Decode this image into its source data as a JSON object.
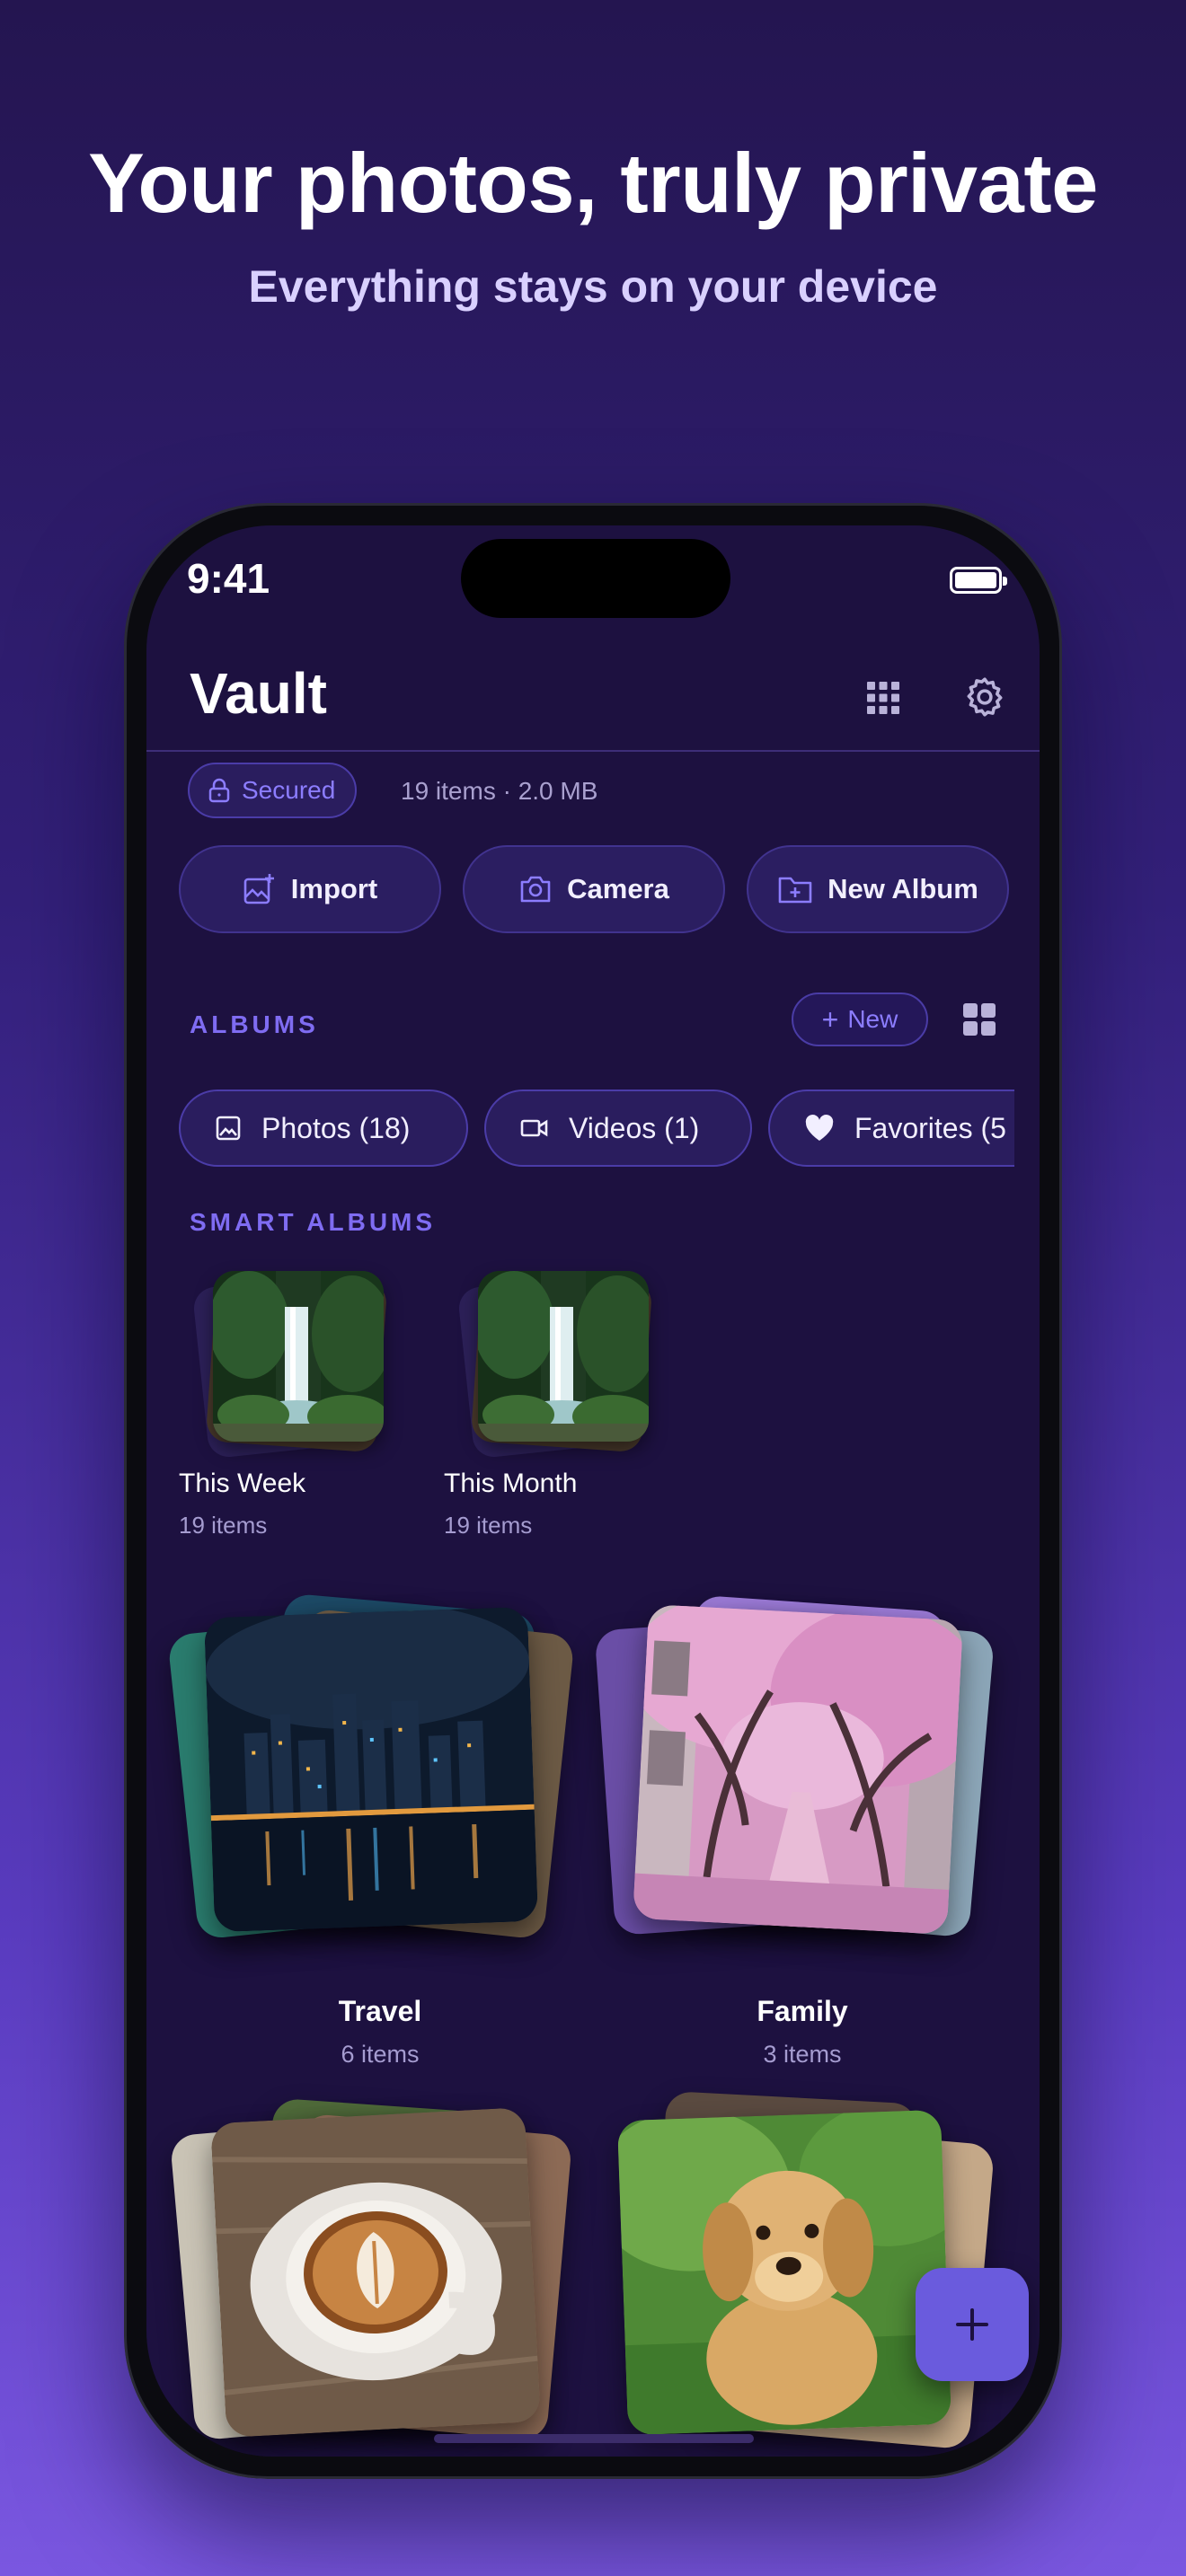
{
  "hero": {
    "title": "Your photos, truly private",
    "subtitle": "Everything stays on your device"
  },
  "status_bar": {
    "time": "9:41"
  },
  "header": {
    "title": "Vault",
    "grid_icon": "grid-icon",
    "settings_icon": "gear-icon"
  },
  "info": {
    "badge": "Secured",
    "meta": "19 items · 2.0 MB"
  },
  "actions": [
    {
      "label": "Import",
      "icon": "import-photo-icon"
    },
    {
      "label": "Camera",
      "icon": "camera-icon"
    },
    {
      "label": "New Album",
      "icon": "folder-plus-icon"
    }
  ],
  "albums_section": {
    "label": "ALBUMS",
    "new_button": "New"
  },
  "chips": [
    {
      "label": "Photos (18)",
      "icon": "image-icon"
    },
    {
      "label": "Videos (1)",
      "icon": "video-icon"
    },
    {
      "label": "Favorites (5",
      "icon": "heart-icon"
    }
  ],
  "smart_section": {
    "label": "SMART ALBUMS"
  },
  "smart_albums": [
    {
      "name": "This Week",
      "count": "19 items"
    },
    {
      "name": "This Month",
      "count": "19 items"
    }
  ],
  "albums": [
    {
      "name": "Travel",
      "count": "6 items"
    },
    {
      "name": "Family",
      "count": "3 items"
    }
  ],
  "colors": {
    "accent": "#7f6cf2",
    "screen_bg": "#1d1140",
    "fab": "#6a5bdd"
  }
}
